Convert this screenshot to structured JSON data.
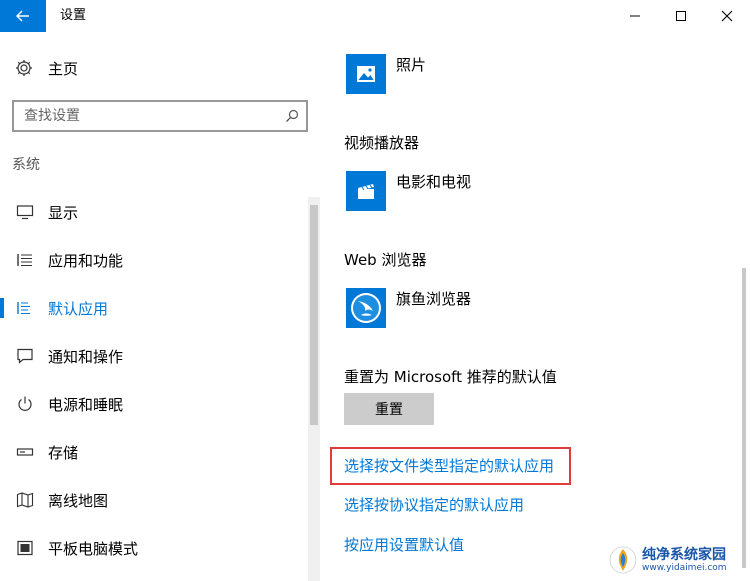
{
  "titlebar": {
    "title": "设置",
    "back_icon": "arrow-left-icon",
    "accent": "#0078d7"
  },
  "sidebar": {
    "home_label": "主页",
    "search_placeholder": "查找设置",
    "section_title": "系统",
    "items": [
      {
        "label": "显示",
        "icon": "monitor-icon"
      },
      {
        "label": "应用和功能",
        "icon": "list-icon"
      },
      {
        "label": "默认应用",
        "icon": "default-apps-icon",
        "active": true
      },
      {
        "label": "通知和操作",
        "icon": "notification-icon"
      },
      {
        "label": "电源和睡眠",
        "icon": "power-icon"
      },
      {
        "label": "存储",
        "icon": "storage-icon"
      },
      {
        "label": "离线地图",
        "icon": "map-icon"
      },
      {
        "label": "平板电脑模式",
        "icon": "tablet-icon"
      }
    ]
  },
  "main": {
    "photo_app": "照片",
    "video_title": "视频播放器",
    "video_app": "电影和电视",
    "browser_title": "Web 浏览器",
    "browser_app": "旗鱼浏览器",
    "reset_label": "重置为 Microsoft 推荐的默认值",
    "reset_button": "重置",
    "links": [
      "选择按文件类型指定的默认应用",
      "选择按协议指定的默认应用",
      "按应用设置默认值"
    ],
    "highlight_color": "#e33b3b"
  },
  "watermark": {
    "title": "纯净系统家园",
    "url": "www.yidaimei.com"
  }
}
